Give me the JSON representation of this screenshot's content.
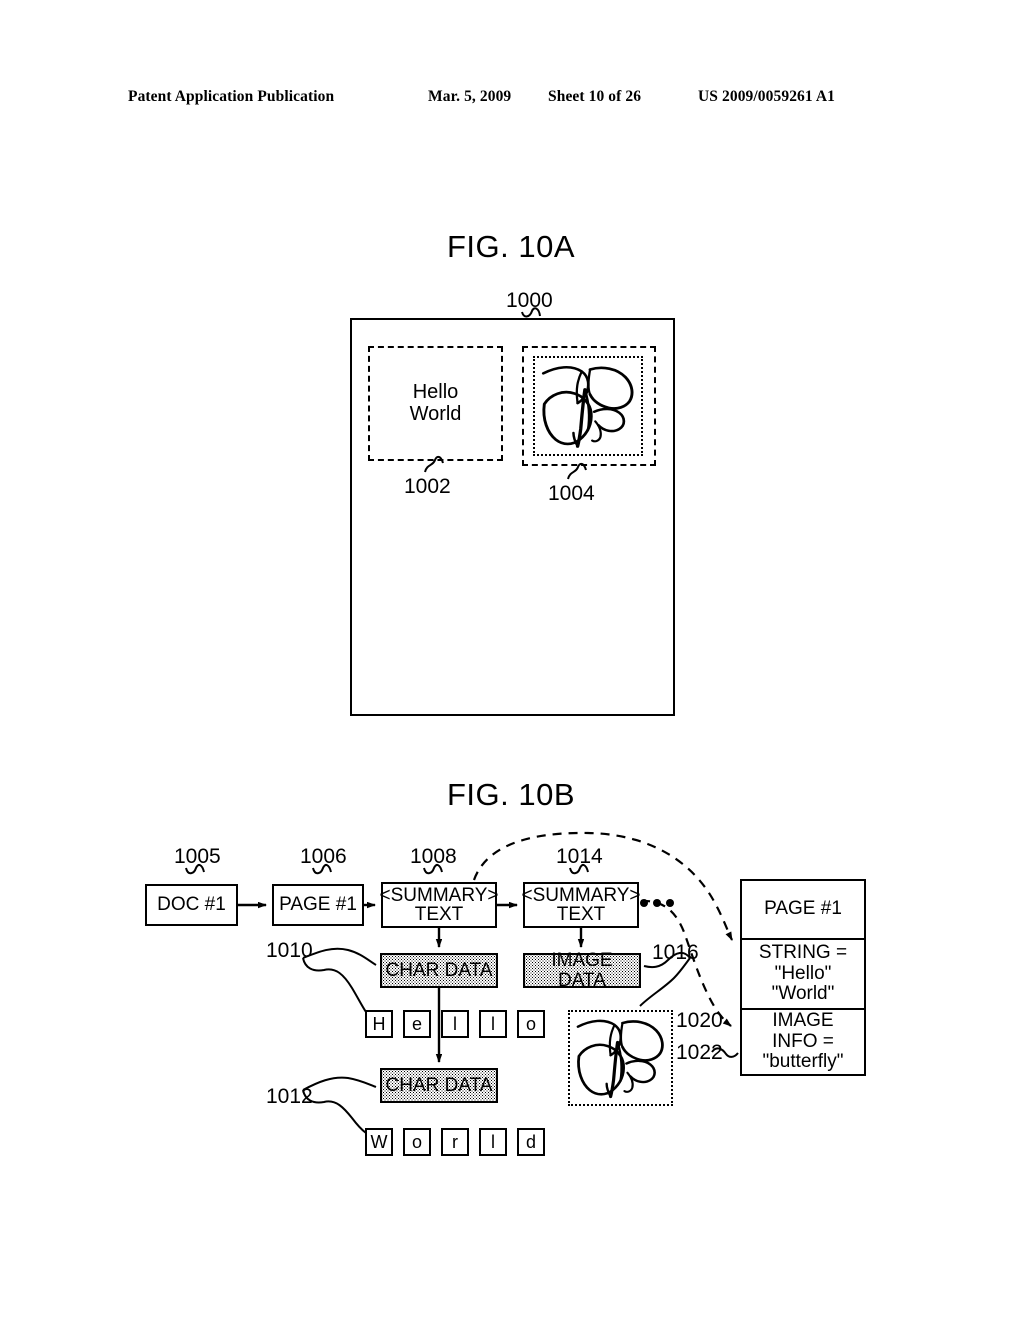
{
  "header": {
    "publication": "Patent Application Publication",
    "date": "Mar. 5, 2009",
    "sheet": "Sheet 10 of 26",
    "number": "US 2009/0059261 A1"
  },
  "figures": {
    "fig_a_title": "FIG. 10A",
    "fig_b_title": "FIG. 10B"
  },
  "fig10a": {
    "page_ref": "1000",
    "text_region": {
      "ref": "1002",
      "content": "Hello\nWorld"
    },
    "image_region": {
      "ref": "1004",
      "subject": "butterfly"
    }
  },
  "fig10b": {
    "nodes": [
      {
        "ref": "1005",
        "label": "DOC #1"
      },
      {
        "ref": "1006",
        "label": "PAGE #1"
      },
      {
        "ref": "1008",
        "label": "<SUMMARY>\nTEXT"
      },
      {
        "ref": "1014",
        "label": "<SUMMARY>\nTEXT"
      }
    ],
    "char_data_1": {
      "ref": "1010",
      "label": "CHAR DATA",
      "chars": [
        "H",
        "e",
        "l",
        "l",
        "o"
      ]
    },
    "char_data_2": {
      "ref": "1012",
      "label": "CHAR DATA",
      "chars": [
        "W",
        "o",
        "r",
        "l",
        "d"
      ]
    },
    "image_data": {
      "ref": "1016",
      "label": "IMAGE DATA",
      "subject": "butterfly"
    },
    "ellipsis": "•••",
    "result_panel": {
      "rows": [
        {
          "text": "PAGE #1"
        },
        {
          "ref": "1020",
          "text": "STRING =\n\"Hello\"\n\"World\""
        },
        {
          "ref": "1022",
          "text": "IMAGE\nINFO =\n\"butterfly\""
        }
      ]
    }
  }
}
